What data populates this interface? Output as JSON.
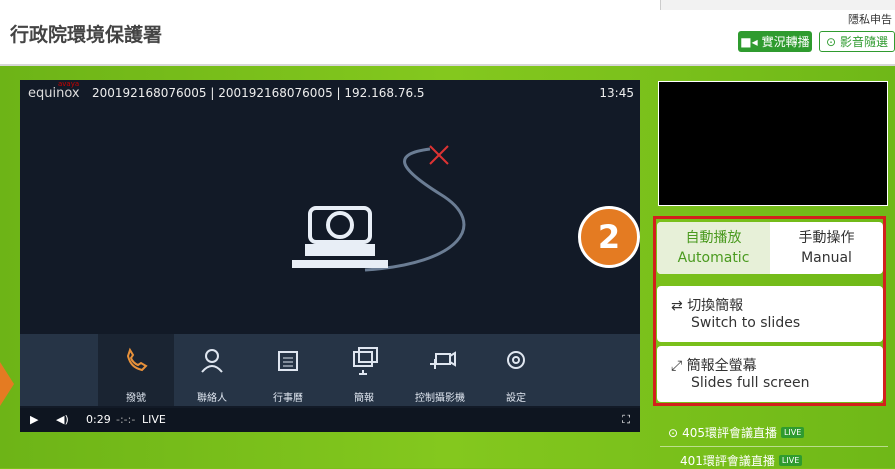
{
  "header": {
    "title": "行政院環境保護署",
    "top_link": "隱私申告",
    "live_button": "實況轉播",
    "video_button": "影音隨選"
  },
  "player": {
    "logo": "equinox",
    "logo_small": "avaya",
    "info": "200192168076005 | 200192168076005 | 192.168.76.5",
    "clock": "13:45",
    "toolbar": [
      "撥號",
      "聯絡人",
      "行事曆",
      "簡報",
      "控制攝影機",
      "設定"
    ],
    "time": "0:29",
    "time2": "-:-:-",
    "live": "LIVE"
  },
  "panel": {
    "badge": "2",
    "auto_zh": "自動播放",
    "auto_en": "Automatic",
    "manual_zh": "手動操作",
    "manual_en": "Manual",
    "switch_zh": "切換簡報",
    "switch_en": "Switch to slides",
    "full_zh": "簡報全螢幕",
    "full_en": "Slides full screen"
  },
  "live_list": [
    {
      "title": "405環評會議直播",
      "tag": "LIVE"
    },
    {
      "title": "401環評會議直播",
      "tag": "LIVE"
    }
  ],
  "colors": {
    "accent_green": "#2f9b2f",
    "highlight": "#d2201c",
    "badge": "#e47b22"
  }
}
